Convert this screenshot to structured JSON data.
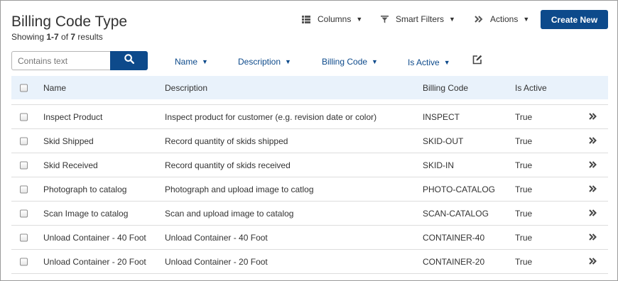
{
  "header": {
    "title": "Billing Code Type",
    "showing_prefix": "Showing ",
    "showing_range": "1-7",
    "showing_of": " of ",
    "showing_total": "7",
    "showing_suffix": " results"
  },
  "toolbar": {
    "columns_label": "Columns",
    "smart_filters_label": "Smart Filters",
    "actions_label": "Actions",
    "create_label": "Create New"
  },
  "search": {
    "placeholder": "Contains text",
    "value": ""
  },
  "filters": {
    "name_label": "Name",
    "description_label": "Description",
    "billing_code_label": "Billing Code",
    "is_active_label": "Is Active"
  },
  "table": {
    "columns": {
      "name": "Name",
      "description": "Description",
      "billing_code": "Billing Code",
      "is_active": "Is Active"
    },
    "rows": [
      {
        "name": "Inspect Product",
        "description": "Inspect product for customer (e.g. revision date or color)",
        "billing_code": "INSPECT",
        "is_active": "True"
      },
      {
        "name": "Skid Shipped",
        "description": "Record quantity of skids shipped",
        "billing_code": "SKID-OUT",
        "is_active": "True"
      },
      {
        "name": "Skid Received",
        "description": "Record quantity of skids received",
        "billing_code": "SKID-IN",
        "is_active": "True"
      },
      {
        "name": "Photograph to catalog",
        "description": "Photograph and upload image to catlog",
        "billing_code": "PHOTO-CATALOG",
        "is_active": "True"
      },
      {
        "name": "Scan Image to catalog",
        "description": "Scan and upload image to catalog",
        "billing_code": "SCAN-CATALOG",
        "is_active": "True"
      },
      {
        "name": "Unload Container - 40 Foot",
        "description": "Unload Container - 40 Foot",
        "billing_code": "CONTAINER-40",
        "is_active": "True"
      },
      {
        "name": "Unload Container - 20 Foot",
        "description": "Unload Container - 20 Foot",
        "billing_code": "CONTAINER-20",
        "is_active": "True"
      }
    ]
  },
  "icons": {
    "columns": "columns-list-icon",
    "smart_filters": "funnel-icon",
    "actions": "double-chevron-right-icon",
    "search": "search-icon",
    "edit_columns": "edit-square-icon",
    "row_open": "double-chevron-right-icon"
  },
  "colors": {
    "brand": "#0d4a8b",
    "header_bg": "#e9f2fb",
    "divider": "#dddddd"
  }
}
